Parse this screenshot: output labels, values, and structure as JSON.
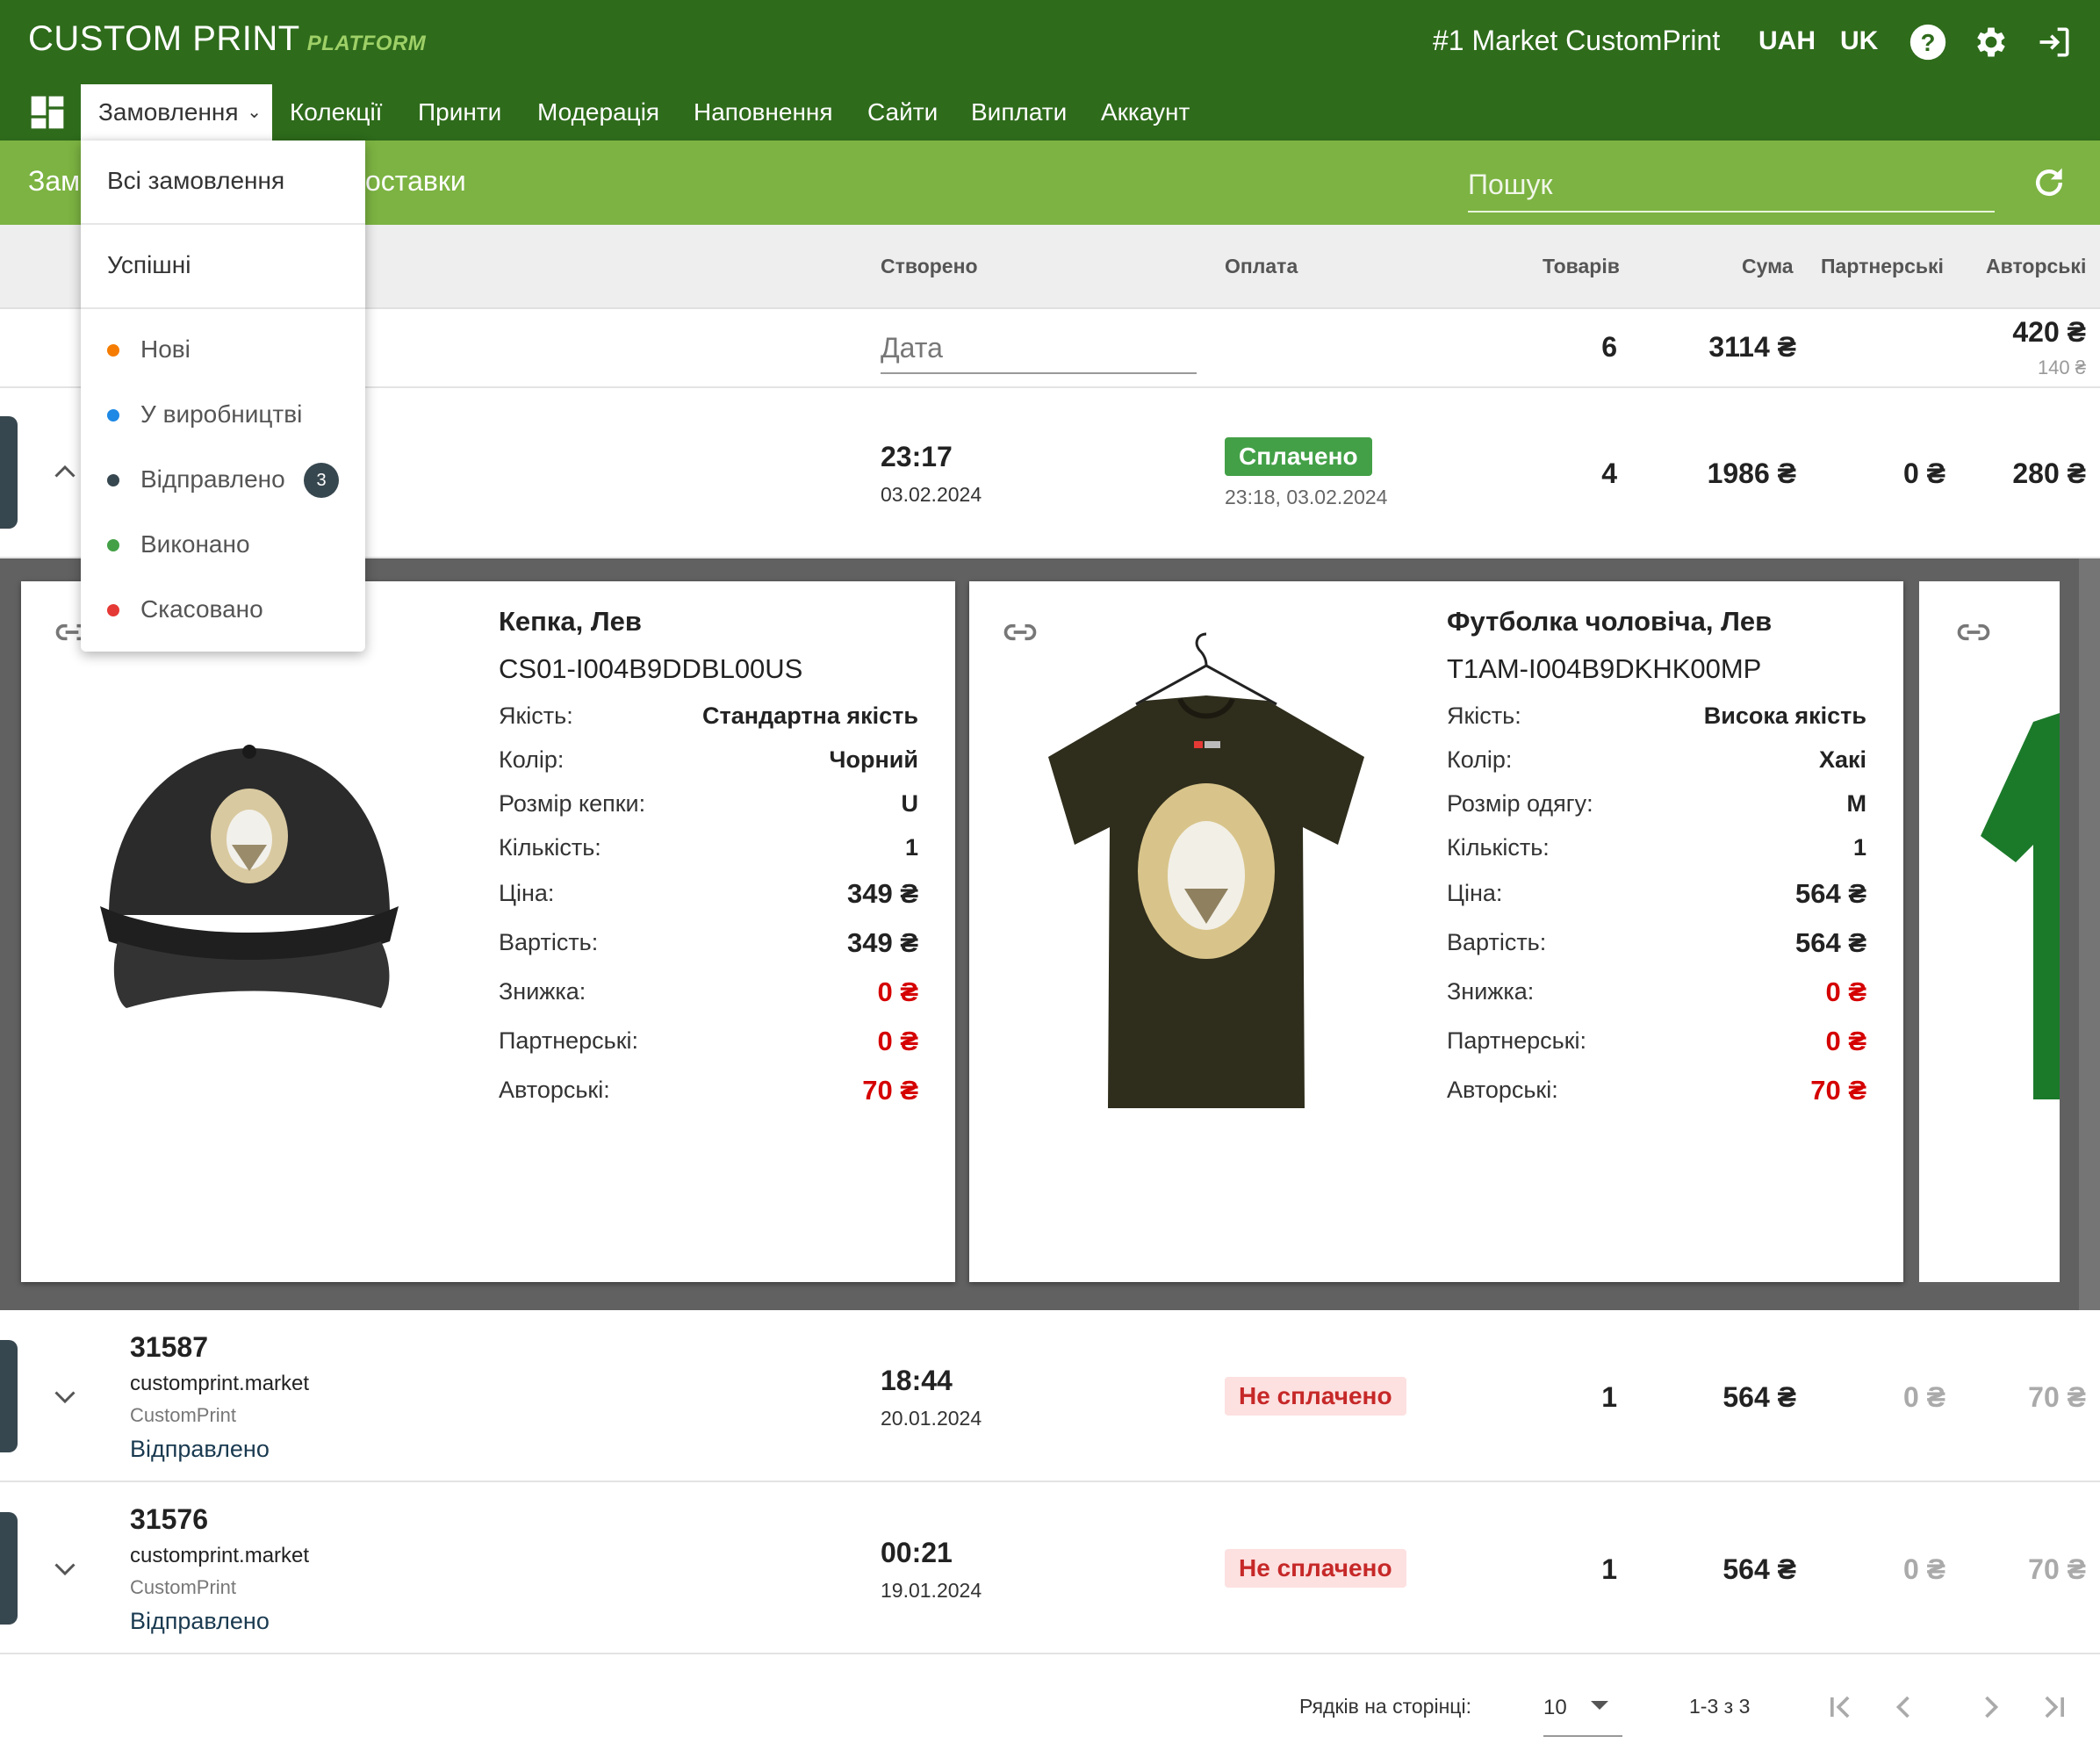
{
  "header": {
    "brand": "CUSTOM PRINT",
    "brand_sub": "PLATFORM",
    "market": "#1 Market CustomPrint",
    "currency": "UAH",
    "language": "UK"
  },
  "nav": {
    "items": [
      "Замовлення",
      "Колекції",
      "Принти",
      "Модерація",
      "Наповнення",
      "Сайти",
      "Виплати",
      "Аккаунт"
    ]
  },
  "subbar": {
    "title_left": "Зам",
    "title_right": "оставки",
    "search_placeholder": "Пошук"
  },
  "dropdown": {
    "all_orders": "Всі замовлення",
    "successful": "Успішні",
    "statuses": [
      {
        "label": "Нові",
        "color": "#f57c00"
      },
      {
        "label": "У виробництві",
        "color": "#1e88e5"
      },
      {
        "label": "Відправлено",
        "color": "#37474f",
        "count": "3"
      },
      {
        "label": "Виконано",
        "color": "#43a047"
      },
      {
        "label": "Скасовано",
        "color": "#e53935"
      }
    ]
  },
  "table": {
    "columns": [
      "Створено",
      "Оплата",
      "Товарів",
      "Сума",
      "Партнерські",
      "Авторські"
    ],
    "filter": {
      "date_placeholder": "Дата",
      "items_total": "6",
      "sum_total": "3114 ₴",
      "author_total": "420 ₴",
      "author_sub": "140 ₴"
    },
    "rows": [
      {
        "time": "23:17",
        "date": "03.02.2024",
        "payment": "Сплачено",
        "payment_time": "23:18, 03.02.2024",
        "items": "4",
        "sum": "1986 ₴",
        "partner": "0 ₴",
        "author": "280 ₴"
      },
      {
        "id": "31587",
        "site": "customprint.market",
        "shop": "CustomPrint",
        "status": "Відправлено",
        "time": "18:44",
        "date": "20.01.2024",
        "payment": "Не сплачено",
        "items": "1",
        "sum": "564 ₴",
        "partner": "0 ₴",
        "author": "70 ₴"
      },
      {
        "id": "31576",
        "site": "customprint.market",
        "shop": "CustomPrint",
        "status": "Відправлено",
        "time": "00:21",
        "date": "19.01.2024",
        "payment": "Не сплачено",
        "items": "1",
        "sum": "564 ₴",
        "partner": "0 ₴",
        "author": "70 ₴"
      }
    ]
  },
  "products": [
    {
      "title": "Кепка, Лев",
      "sku": "CS01-I004B9DDBL00US",
      "fields": [
        {
          "label": "Якість:",
          "value": "Стандартна якість"
        },
        {
          "label": "Колір:",
          "value": "Чорний"
        },
        {
          "label": "Розмір кепки:",
          "value": "U"
        },
        {
          "label": "Кількість:",
          "value": "1"
        },
        {
          "label": "Ціна:",
          "value": "349 ₴"
        },
        {
          "label": "Вартість:",
          "value": "349 ₴"
        },
        {
          "label": "Знижка:",
          "value": "0 ₴"
        },
        {
          "label": "Партнерські:",
          "value": "0 ₴"
        },
        {
          "label": "Авторські:",
          "value": "70 ₴"
        }
      ]
    },
    {
      "title": "Футболка чоловіча, Лев",
      "sku": "T1AM-I004B9DKHK00MP",
      "fields": [
        {
          "label": "Якість:",
          "value": "Висока якість"
        },
        {
          "label": "Колір:",
          "value": "Хакі"
        },
        {
          "label": "Розмір одягу:",
          "value": "M"
        },
        {
          "label": "Кількість:",
          "value": "1"
        },
        {
          "label": "Ціна:",
          "value": "564 ₴"
        },
        {
          "label": "Вартість:",
          "value": "564 ₴"
        },
        {
          "label": "Знижка:",
          "value": "0 ₴"
        },
        {
          "label": "Партнерські:",
          "value": "0 ₴"
        },
        {
          "label": "Авторські:",
          "value": "70 ₴"
        }
      ]
    }
  ],
  "pagination": {
    "rows_label": "Рядків на сторінці:",
    "rows_value": "10",
    "range": "1-3 з 3"
  },
  "colors": {
    "topbar": "#2e6b1b",
    "subbar": "#7cb342",
    "accent_light": "#9ed067",
    "paid": "#43a047",
    "unpaid_bg": "#fde0e0",
    "unpaid_text": "#c62828",
    "negative": "#d50000"
  }
}
